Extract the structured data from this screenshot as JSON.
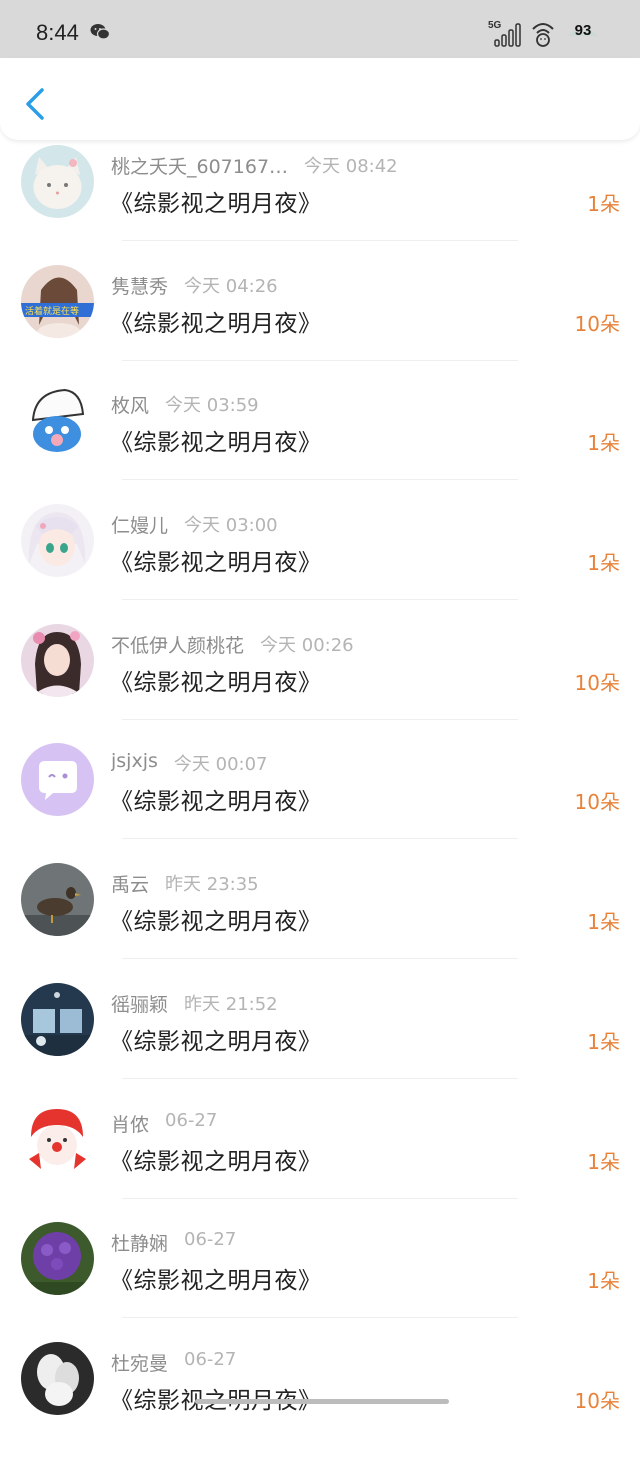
{
  "status_bar": {
    "time": "8:44",
    "network": "5G",
    "battery": "93"
  },
  "nav": {
    "back_icon": "chevron-left-icon",
    "accent_color": "#2b9ee8"
  },
  "colors": {
    "amount": "#e8823a",
    "name": "#8d8d8d",
    "time": "#b4b4b4"
  },
  "rows": [
    {
      "name": "桃之夭夭_607167…",
      "time": "今天 08:42",
      "book": "《综影视之明月夜》",
      "amount": "1朵"
    },
    {
      "name": "隽慧秀",
      "time": "今天 04:26",
      "book": "《综影视之明月夜》",
      "amount": "10朵"
    },
    {
      "name": "枚风",
      "time": "今天 03:59",
      "book": "《综影视之明月夜》",
      "amount": "1朵"
    },
    {
      "name": "仁嫚儿",
      "time": "今天 03:00",
      "book": "《综影视之明月夜》",
      "amount": "1朵"
    },
    {
      "name": "不低伊人颜桃花",
      "time": "今天 00:26",
      "book": "《综影视之明月夜》",
      "amount": "10朵"
    },
    {
      "name": "jsjxjs",
      "time": "今天 00:07",
      "book": "《综影视之明月夜》",
      "amount": "10朵"
    },
    {
      "name": "禹云",
      "time": "昨天 23:35",
      "book": "《综影视之明月夜》",
      "amount": "1朵"
    },
    {
      "name": "徭骊颖",
      "time": "昨天 21:52",
      "book": "《综影视之明月夜》",
      "amount": "1朵"
    },
    {
      "name": "肖侬",
      "time": "06-27",
      "book": "《综影视之明月夜》",
      "amount": "1朵"
    },
    {
      "name": "杜静娴",
      "time": "06-27",
      "book": "《综影视之明月夜》",
      "amount": "1朵"
    },
    {
      "name": "杜宛曼",
      "time": "06-27",
      "book": "《综影视之明月夜》",
      "amount": "10朵"
    }
  ]
}
